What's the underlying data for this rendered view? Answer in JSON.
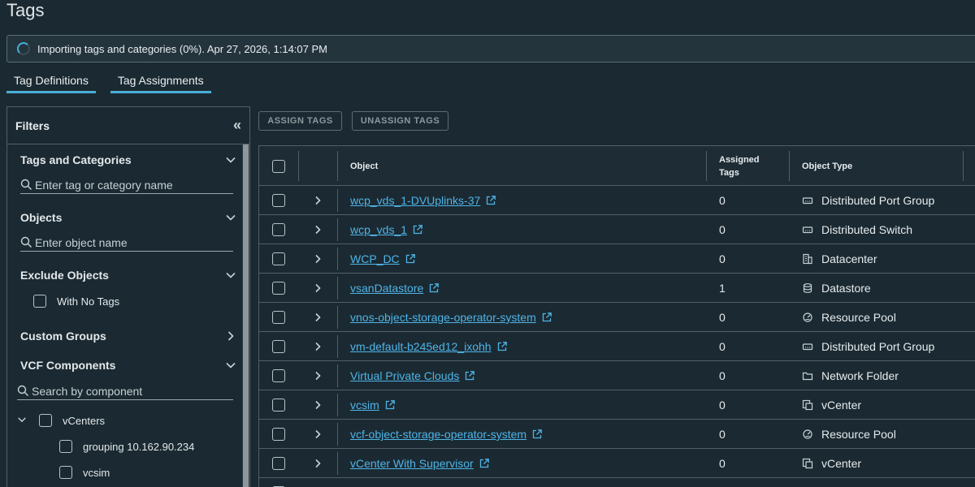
{
  "page": {
    "title": "Tags"
  },
  "alert": {
    "text": "Importing tags and categories (0%). Apr 27, 2026, 1:14:07 PM"
  },
  "tabs": [
    {
      "label": "Tag Definitions",
      "active": true
    },
    {
      "label": "Tag Assignments",
      "active": true
    }
  ],
  "filters": {
    "title": "Filters",
    "sections": {
      "tags": {
        "title": "Tags and Categories",
        "placeholder": "Enter tag or category name"
      },
      "objects": {
        "title": "Objects",
        "placeholder": "Enter object name"
      },
      "exclude": {
        "title": "Exclude Objects",
        "option": "With No Tags"
      },
      "custom": {
        "title": "Custom Groups"
      },
      "vcf": {
        "title": "VCF Components",
        "placeholder": "Search by component",
        "tree_root": "vCenters",
        "children": [
          "grouping 10.162.90.234",
          "vcsim"
        ]
      }
    }
  },
  "actions": {
    "assign": "ASSIGN TAGS",
    "unassign": "UNASSIGN TAGS"
  },
  "grid": {
    "columns": {
      "object": "Object",
      "assigned_line1": "Assigned",
      "assigned_line2": "Tags",
      "type": "Object Type"
    },
    "rows": [
      {
        "object": "wcp_vds_1-DVUplinks-37",
        "assigned": "0",
        "type": "Distributed Port Group",
        "icon": "port-group-icon"
      },
      {
        "object": "wcp_vds_1",
        "assigned": "0",
        "type": "Distributed Switch",
        "icon": "switch-icon"
      },
      {
        "object": "WCP_DC",
        "assigned": "0",
        "type": "Datacenter",
        "icon": "datacenter-icon"
      },
      {
        "object": "vsanDatastore",
        "assigned": "1",
        "type": "Datastore",
        "icon": "datastore-icon"
      },
      {
        "object": "vnos-object-storage-operator-system",
        "assigned": "0",
        "type": "Resource Pool",
        "icon": "resource-pool-icon"
      },
      {
        "object": "vm-default-b245ed12_ixohh",
        "assigned": "0",
        "type": "Distributed Port Group",
        "icon": "port-group-icon"
      },
      {
        "object": "Virtual Private Clouds",
        "assigned": "0",
        "type": "Network Folder",
        "icon": "folder-icon"
      },
      {
        "object": "vcsim",
        "assigned": "0",
        "type": "vCenter",
        "icon": "vcenter-icon"
      },
      {
        "object": "vcf-object-storage-operator-system",
        "assigned": "0",
        "type": "Resource Pool",
        "icon": "resource-pool-icon"
      },
      {
        "object": "vCenter With Supervisor",
        "assigned": "0",
        "type": "vCenter",
        "icon": "vcenter-icon"
      }
    ]
  },
  "colors": {
    "accent": "#49afd9",
    "link": "#4fb4e8",
    "background": "#1b2a32",
    "border": "#4f6069"
  }
}
